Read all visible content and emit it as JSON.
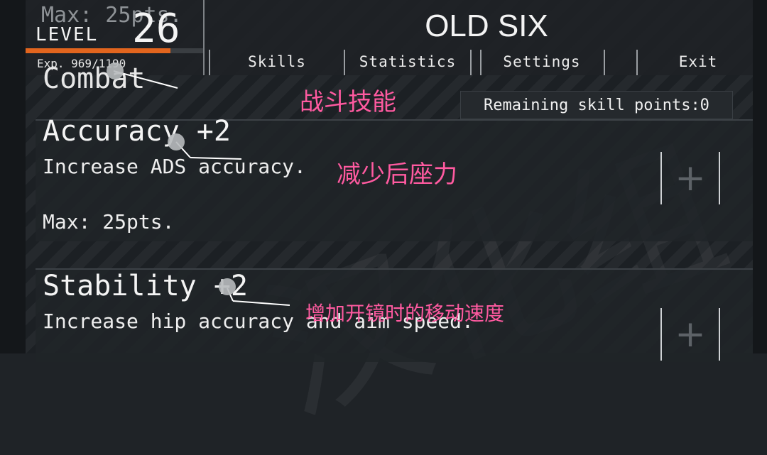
{
  "header": {
    "level_ghost": "Max: 25pts.",
    "level_label": "LEVEL",
    "level_value": "26",
    "exp_text": "Exp. 969/1190",
    "exp_progress": 0.814,
    "title": "OLD SIX",
    "tabs": [
      "Skills",
      "Statistics",
      "Settings",
      "Exit"
    ]
  },
  "content": {
    "section_title": "Combat",
    "remaining_points": "Remaining skill points:0",
    "skills": [
      {
        "name": "Accuracy +2",
        "desc": "Increase ADS accuracy.",
        "max": "Max: 25pts.",
        "button": "+"
      },
      {
        "name": "Stability +2",
        "desc": "Increase hip accuracy and aim speed.",
        "button": "+"
      }
    ]
  },
  "annotations": {
    "combat_cn": "战斗技能",
    "accuracy_cn": "减少后座力",
    "stability_cn": "增加开镜时的移动速度",
    "color": "#ff5aa0"
  },
  "watermark": "汉化组",
  "colors": {
    "accent_exp": "#e2651e",
    "background": "#1f2327"
  }
}
